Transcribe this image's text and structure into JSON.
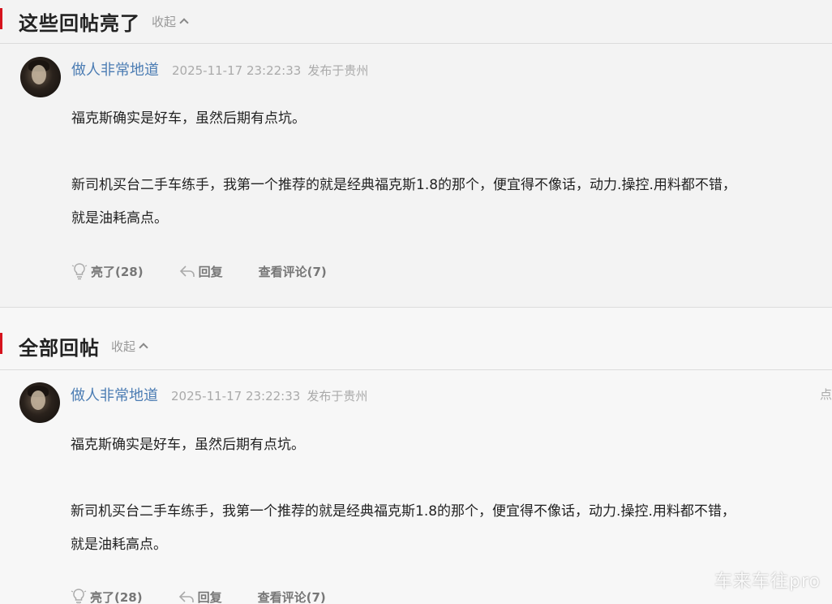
{
  "highlighted": {
    "title": "这些回帖亮了",
    "collapse_label": "收起",
    "post": {
      "username": "做人非常地道",
      "time": "2025-11-17 23:22:33",
      "location": "发布于贵州",
      "paragraphs": [
        "福克斯确实是好车，虽然后期有点坑。",
        "新司机买台二手车练手，我第一个推荐的就是经典福克斯1.8的那个，便宜得不像话，动力.操控.用料都不错，",
        "就是油耗高点。"
      ],
      "actions": {
        "like": "亮了(28)",
        "reply": "回复",
        "comments": "查看评论(7)"
      }
    }
  },
  "all": {
    "title": "全部回帖",
    "collapse_label": "收起",
    "post": {
      "username": "做人非常地道",
      "time": "2025-11-17 23:22:33",
      "location": "发布于贵州",
      "corner": "点",
      "paragraphs": [
        "福克斯确实是好车，虽然后期有点坑。",
        "新司机买台二手车练手，我第一个推荐的就是经典福克斯1.8的那个，便宜得不像话，动力.操控.用料都不错，",
        "就是油耗高点。"
      ],
      "actions": {
        "like": "亮了(28)",
        "reply": "回复",
        "comments": "查看评论(7)"
      }
    }
  },
  "watermark": "车来车往pro",
  "colors": {
    "accent": "#d6131d",
    "username": "#4b7cb3"
  }
}
